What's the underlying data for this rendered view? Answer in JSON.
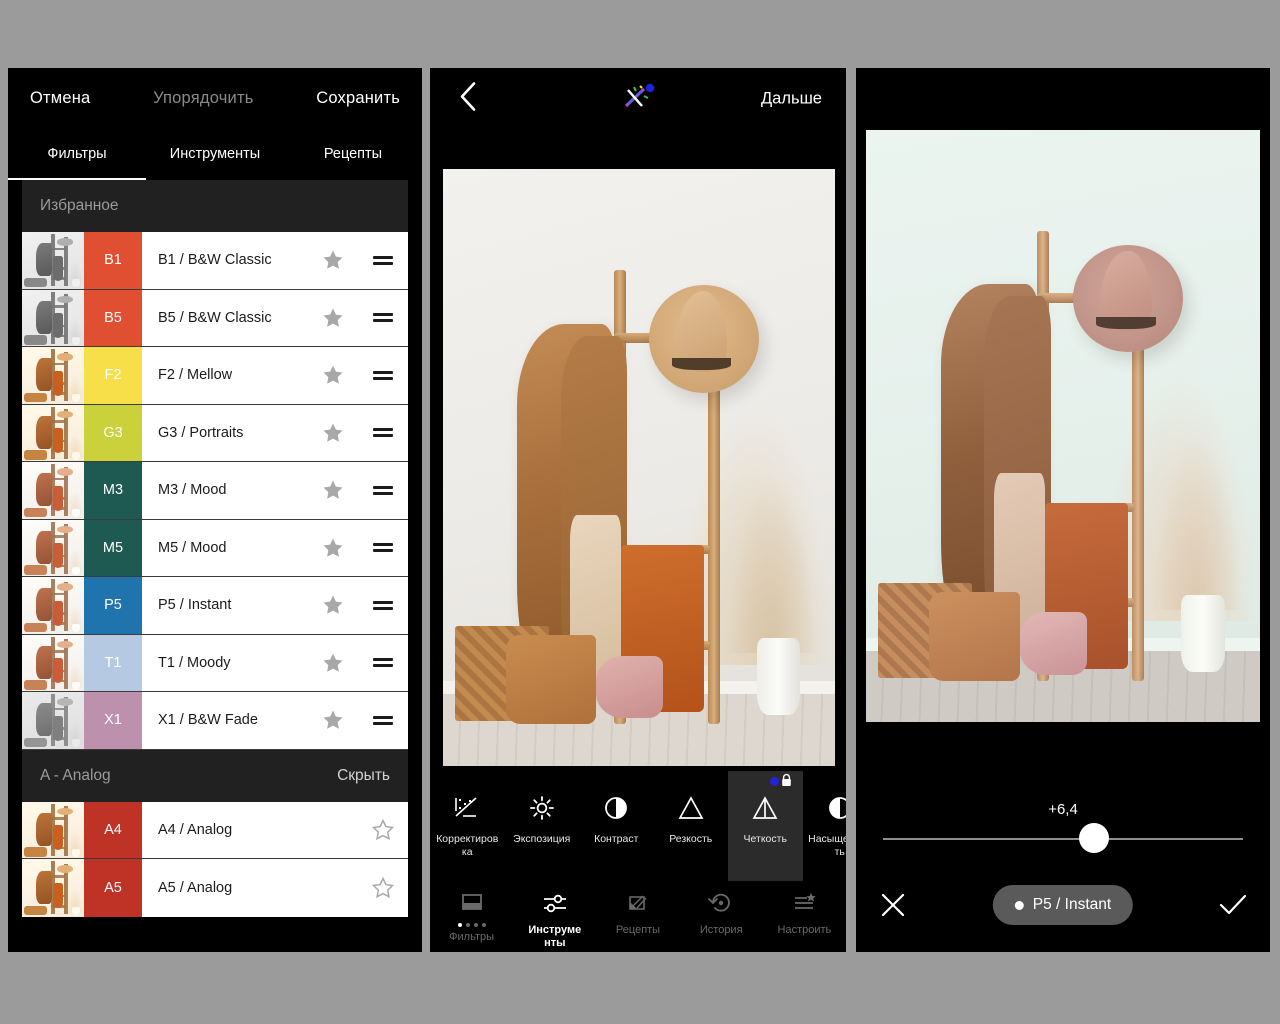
{
  "app": {
    "background_color": "#9b9b9b"
  },
  "left_panel": {
    "topbar": {
      "cancel": "Отмена",
      "organize": "Упорядочить",
      "save": "Сохранить"
    },
    "tabs": [
      {
        "label": "Фильтры",
        "active": true
      },
      {
        "label": "Инструменты",
        "active": false
      },
      {
        "label": "Рецепты",
        "active": false
      }
    ],
    "sections": [
      {
        "title": "Избранное",
        "action": "",
        "rows": [
          {
            "code": "B1",
            "name": "B1 / B&W Classic",
            "color": "#e14f32",
            "starred": true,
            "thumb": "bw"
          },
          {
            "code": "B5",
            "name": "B5 / B&W Classic",
            "color": "#e14f32",
            "starred": true,
            "thumb": "bw"
          },
          {
            "code": "F2",
            "name": "F2 / Mellow",
            "color": "#f7df4a",
            "starred": true,
            "thumb": "warm"
          },
          {
            "code": "G3",
            "name": "G3 / Portraits",
            "color": "#cbd13b",
            "starred": true,
            "thumb": "warm"
          },
          {
            "code": "M3",
            "name": "M3 / Mood",
            "color": "#1f5a52",
            "starred": true,
            "thumb": "cool"
          },
          {
            "code": "M5",
            "name": "M5 / Mood",
            "color": "#1f5a52",
            "starred": true,
            "thumb": "cool"
          },
          {
            "code": "P5",
            "name": "P5 / Instant",
            "color": "#1f74ad",
            "starred": true,
            "thumb": "cool"
          },
          {
            "code": "T1",
            "name": "T1 / Moody",
            "color": "#b6c9e3",
            "starred": true,
            "thumb": "cool"
          },
          {
            "code": "X1",
            "name": "X1 / B&W Fade",
            "color": "#bd90ae",
            "starred": true,
            "thumb": "fade"
          }
        ]
      },
      {
        "title": "A - Analog",
        "action": "Скрыть",
        "rows": [
          {
            "code": "A4",
            "name": "A4 / Analog",
            "color": "#bf3327",
            "starred": false,
            "thumb": "warm"
          },
          {
            "code": "A5",
            "name": "A5 / Analog",
            "color": "#bf3327",
            "starred": false,
            "thumb": "warm"
          }
        ]
      }
    ]
  },
  "middle_panel": {
    "header": {
      "back": "back-chevron",
      "logo": "snapseed-sparkle-logo",
      "next": "Дальше"
    },
    "tools": [
      {
        "label": "Корректиров\nка",
        "icon": "tune-image-icon",
        "selected": false,
        "badge": false
      },
      {
        "label": "Экспозиция",
        "icon": "brightness-icon",
        "selected": false,
        "badge": false
      },
      {
        "label": "Контраст",
        "icon": "contrast-icon",
        "selected": false,
        "badge": false
      },
      {
        "label": "Резкость",
        "icon": "triangle-icon",
        "selected": false,
        "badge": false
      },
      {
        "label": "Четкость",
        "icon": "structure-icon",
        "selected": true,
        "badge": true
      },
      {
        "label": "Насыщеннос\nть",
        "icon": "saturation-icon",
        "selected": false,
        "badge": false
      }
    ],
    "nav": [
      {
        "label": "Фильтры",
        "icon": "filters-icon",
        "active": false,
        "dots": 4,
        "dots_active": 1
      },
      {
        "label": "Инструме\nнты",
        "icon": "sliders-icon",
        "active": true,
        "dots": 0,
        "dots_active": 0
      },
      {
        "label": "Рецепты",
        "icon": "recipes-icon",
        "active": false,
        "dots": 0,
        "dots_active": 0
      },
      {
        "label": "История",
        "icon": "history-icon",
        "active": false,
        "dots": 0,
        "dots_active": 0
      },
      {
        "label": "Настроить",
        "icon": "adjust-icon",
        "active": false,
        "dots": 0,
        "dots_active": 0
      }
    ]
  },
  "right_panel": {
    "slider": {
      "value": "+6,4",
      "position_percent": 57.5
    },
    "bottom": {
      "cancel_icon": "close-icon",
      "confirm_icon": "check-icon",
      "preset_label": "P5 / Instant"
    }
  }
}
